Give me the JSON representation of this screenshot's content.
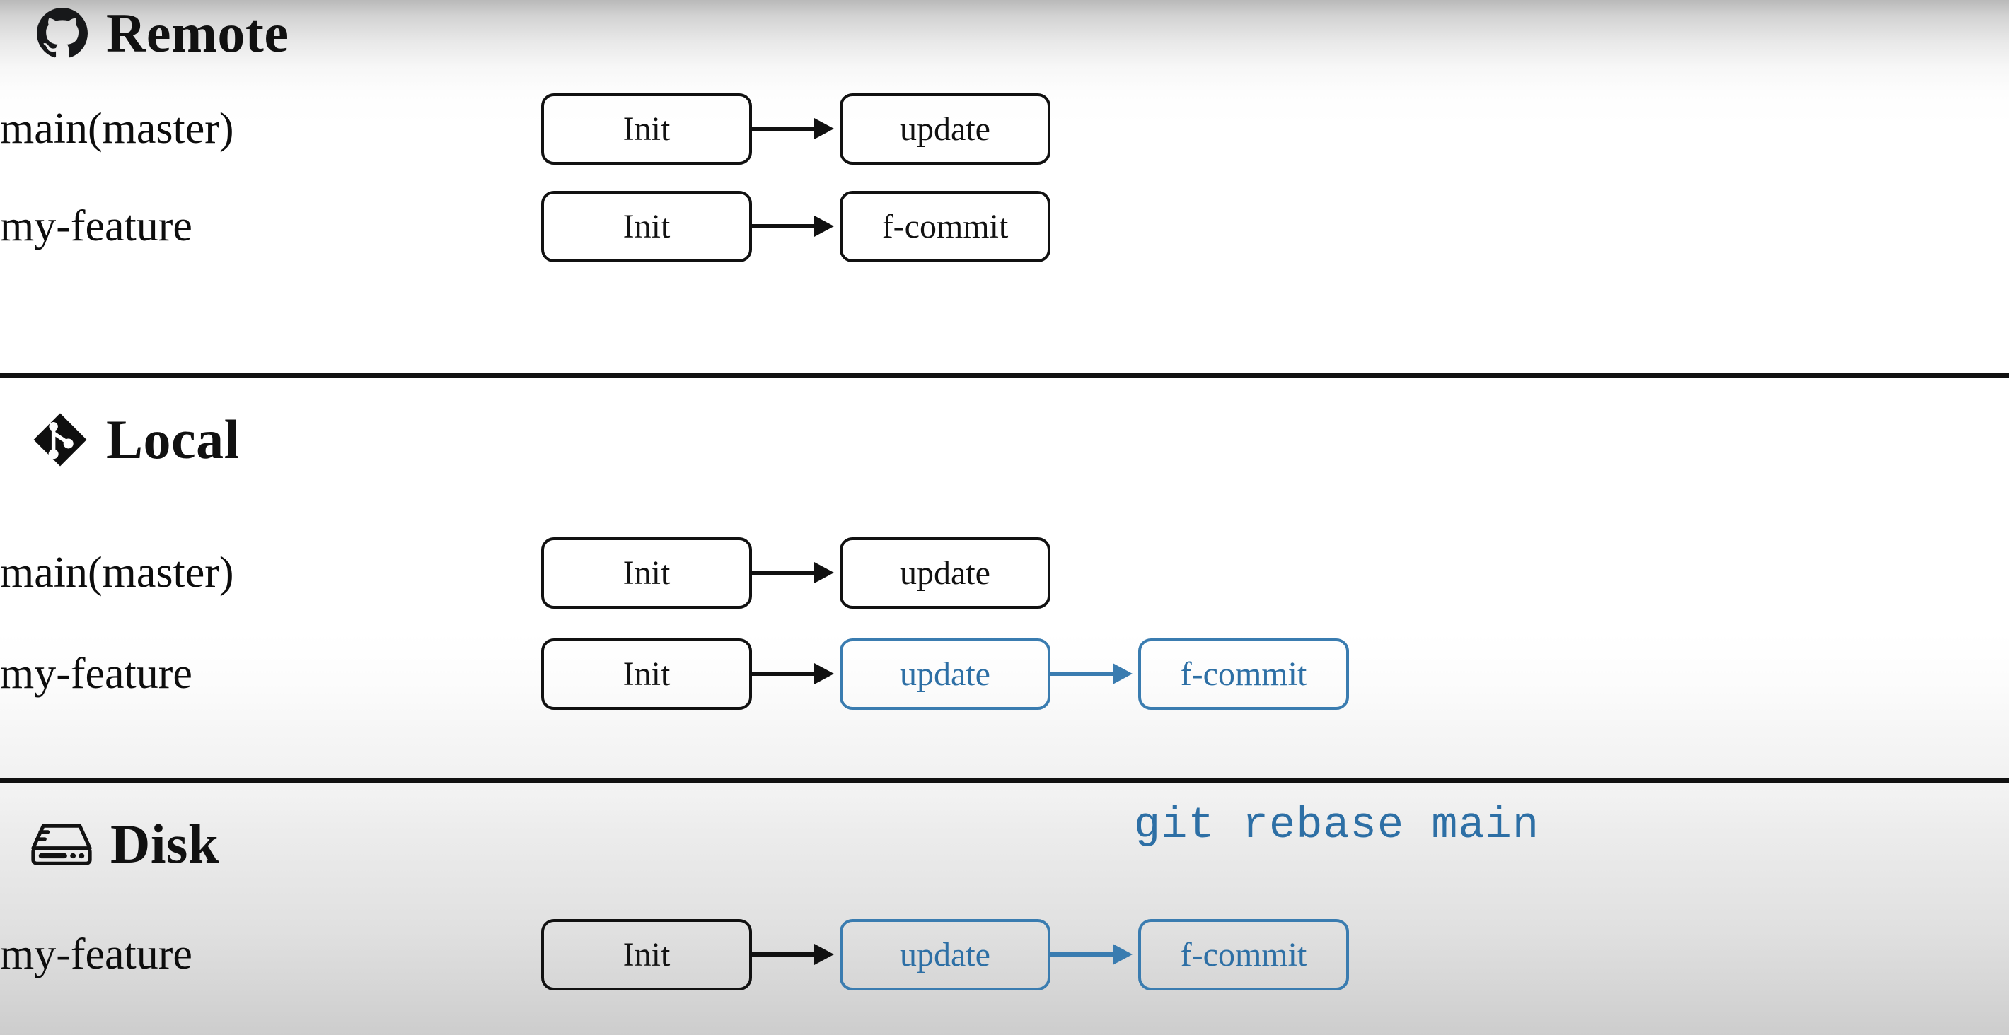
{
  "sections": [
    {
      "id": "remote",
      "title": "Remote",
      "icon": "github-icon",
      "rows": [
        {
          "branch": "main(master)",
          "commits": [
            {
              "label": "Init",
              "color": "black"
            },
            {
              "label": "update",
              "color": "black"
            }
          ],
          "arrows": [
            "black"
          ]
        },
        {
          "branch": "my-feature",
          "commits": [
            {
              "label": "Init",
              "color": "black"
            },
            {
              "label": "f-commit",
              "color": "black"
            }
          ],
          "arrows": [
            "black"
          ]
        }
      ]
    },
    {
      "id": "local",
      "title": "Local",
      "icon": "git-icon",
      "rows": [
        {
          "branch": "main(master)",
          "commits": [
            {
              "label": "Init",
              "color": "black"
            },
            {
              "label": "update",
              "color": "black"
            }
          ],
          "arrows": [
            "black"
          ]
        },
        {
          "branch": "my-feature",
          "commits": [
            {
              "label": "Init",
              "color": "black"
            },
            {
              "label": "update",
              "color": "blue"
            },
            {
              "label": "f-commit",
              "color": "blue"
            }
          ],
          "arrows": [
            "black",
            "blue"
          ]
        }
      ]
    },
    {
      "id": "disk",
      "title": "Disk",
      "icon": "harddrive-icon",
      "caption": "git rebase main",
      "rows": [
        {
          "branch": "my-feature",
          "commits": [
            {
              "label": "Init",
              "color": "black"
            },
            {
              "label": "update",
              "color": "blue"
            },
            {
              "label": "f-commit",
              "color": "blue"
            }
          ],
          "arrows": [
            "black",
            "blue"
          ]
        }
      ]
    }
  ],
  "colors": {
    "accent_blue": "#2d6fa5",
    "border_blue": "#3a7cb0",
    "ink": "#111111"
  }
}
